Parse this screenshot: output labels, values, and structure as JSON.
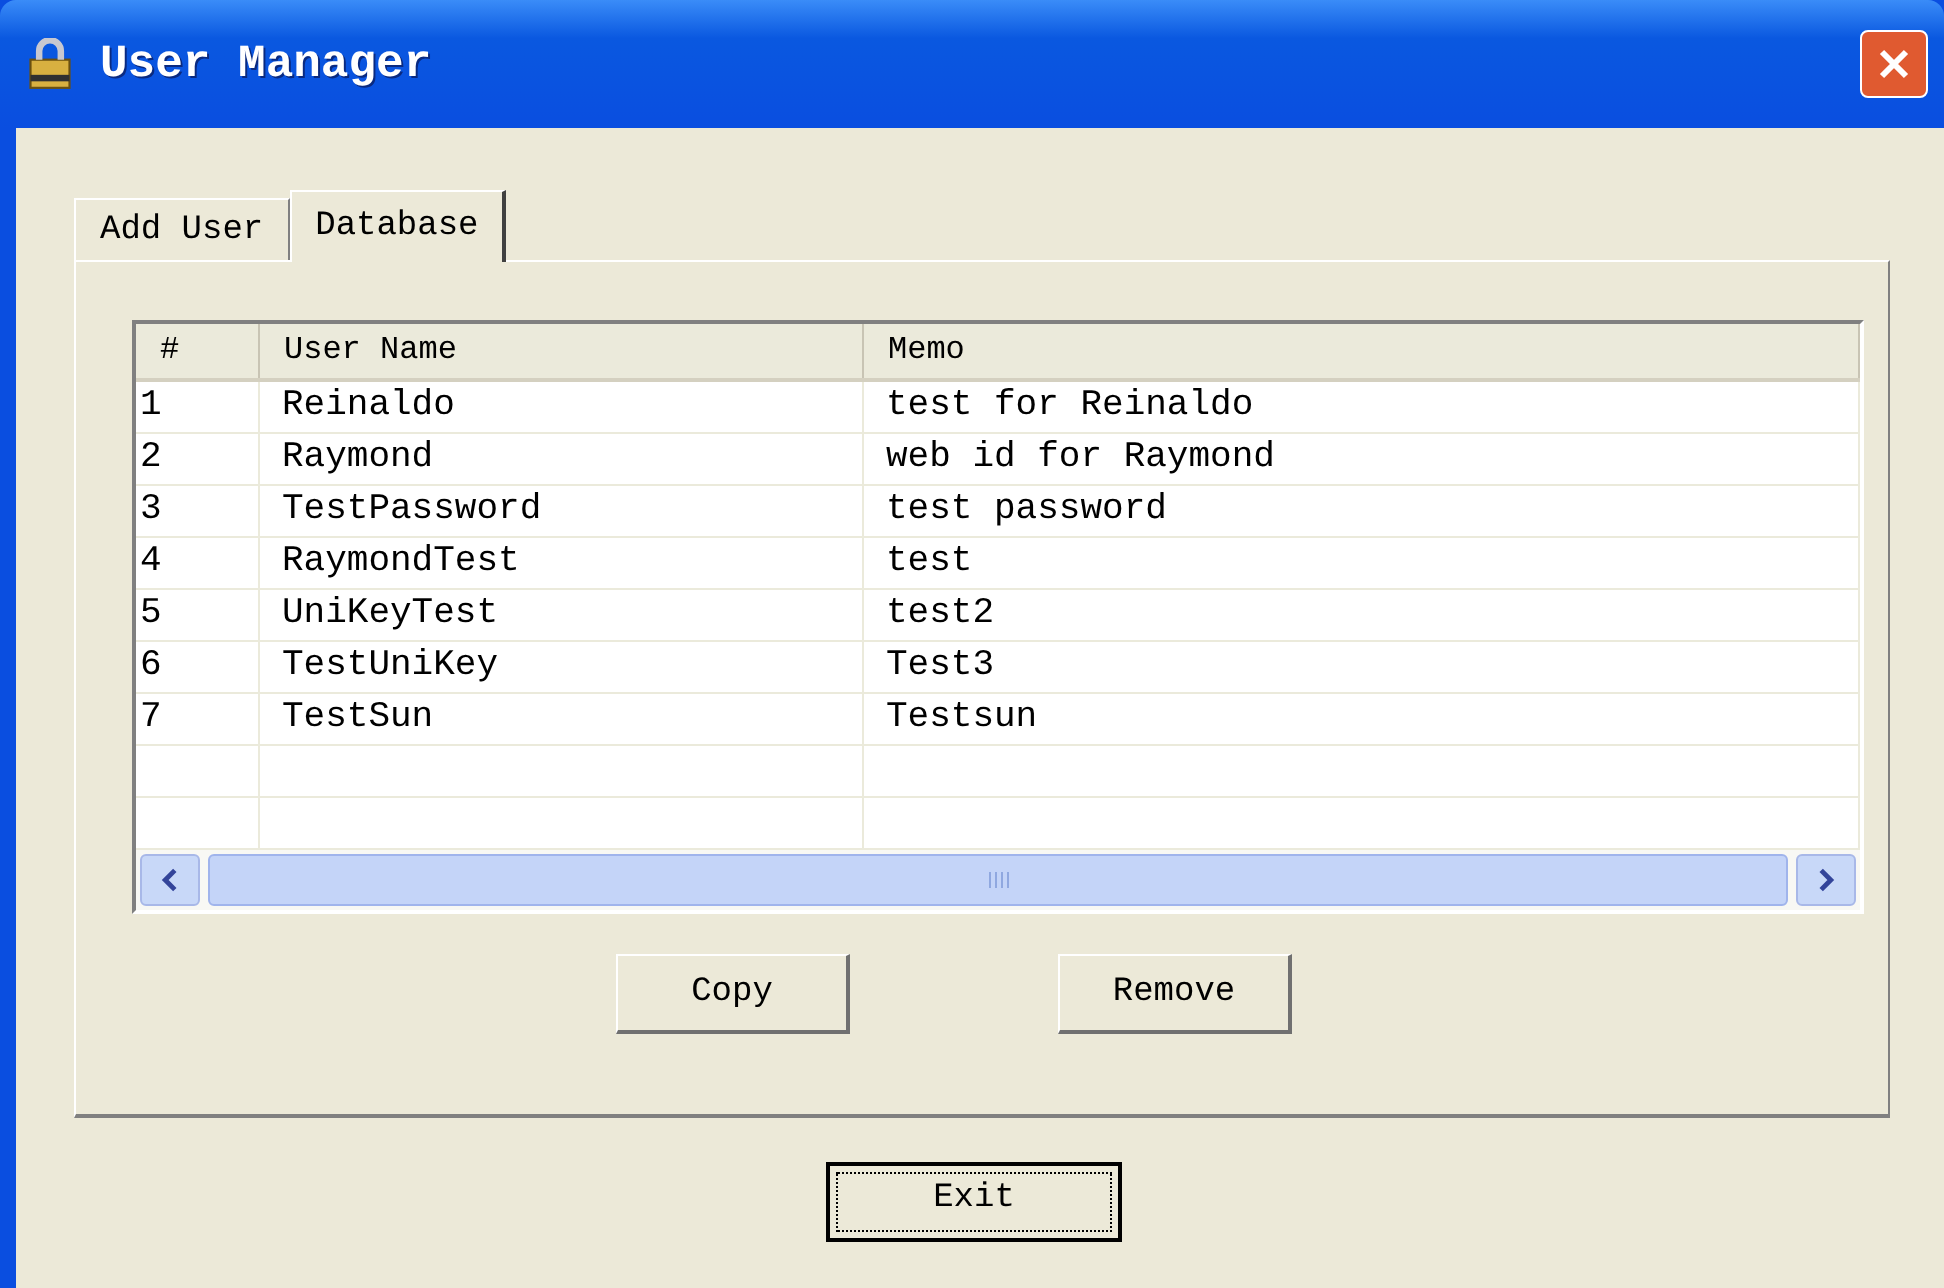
{
  "window": {
    "title": "User Manager"
  },
  "tabs": [
    {
      "label": "Add User",
      "selected": false
    },
    {
      "label": "Database",
      "selected": true
    }
  ],
  "table": {
    "columns": [
      "#",
      "User Name",
      "Memo"
    ],
    "rows": [
      [
        "1",
        "Reinaldo",
        "test for Reinaldo"
      ],
      [
        "2",
        "Raymond",
        "web id for Raymond"
      ],
      [
        "3",
        "TestPassword",
        "test password"
      ],
      [
        "4",
        "RaymondTest",
        "test"
      ],
      [
        "5",
        "UniKeyTest",
        "test2"
      ],
      [
        "6",
        "TestUniKey",
        "Test3"
      ],
      [
        "7",
        "TestSun",
        "Testsun"
      ]
    ]
  },
  "panel_buttons": [
    "Copy",
    "Remove"
  ],
  "exit_button": {
    "label": "Exit",
    "focused": true
  }
}
